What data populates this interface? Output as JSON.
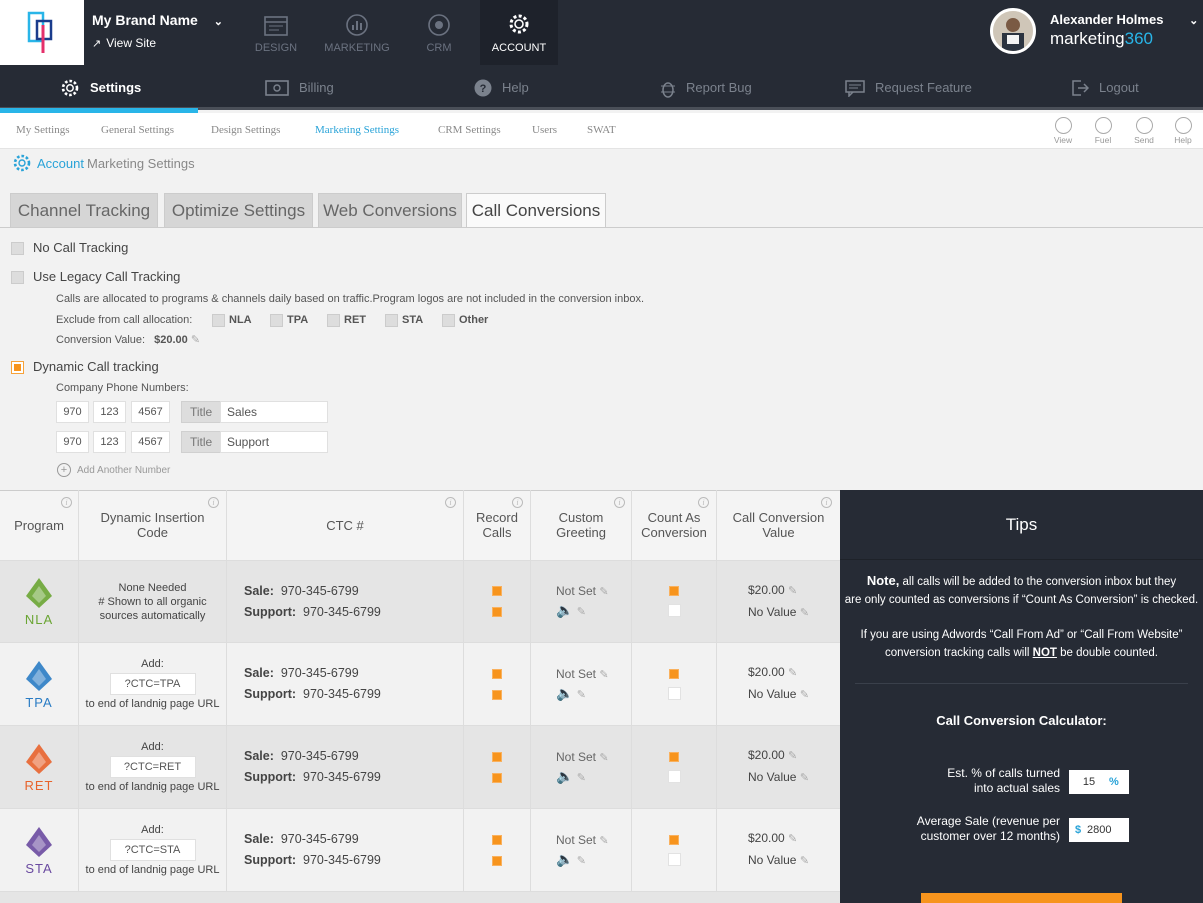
{
  "brand": {
    "name": "My Brand Name",
    "view_site": "View Site"
  },
  "topnav": [
    {
      "label": "DESIGN"
    },
    {
      "label": "MARKETING"
    },
    {
      "label": "CRM"
    },
    {
      "label": "ACCOUNT"
    }
  ],
  "user": {
    "name": "Alexander Holmes",
    "product_a": "marketing",
    "product_b": "360"
  },
  "subnav": [
    {
      "label": "Settings"
    },
    {
      "label": "Billing"
    },
    {
      "label": "Help"
    },
    {
      "label": "Report Bug"
    },
    {
      "label": "Request Feature"
    },
    {
      "label": "Logout"
    }
  ],
  "settingstabs": [
    {
      "label": "My Settings"
    },
    {
      "label": "General Settings"
    },
    {
      "label": "Design Settings"
    },
    {
      "label": "Marketing Settings"
    },
    {
      "label": "CRM Settings"
    },
    {
      "label": "Users"
    },
    {
      "label": "SWAT"
    }
  ],
  "righticons": [
    {
      "label": "View"
    },
    {
      "label": "Fuel"
    },
    {
      "label": "Send"
    },
    {
      "label": "Help"
    }
  ],
  "breadcrumb": {
    "account": "Account",
    "page": "Marketing Settings"
  },
  "maintabs": [
    {
      "label": "Channel Tracking"
    },
    {
      "label": "Optimize Settings"
    },
    {
      "label": "Web Conversions"
    },
    {
      "label": "Call Conversions"
    }
  ],
  "options": {
    "none": "No Call Tracking",
    "legacy": "Use Legacy Call Tracking",
    "legacy_desc": "Calls are allocated to programs & channels daily based on traffic.Program logos are not included in the conversion inbox.",
    "exclude_label": "Exclude from call allocation:",
    "exclude": [
      "NLA",
      "TPA",
      "RET",
      "STA",
      "Other"
    ],
    "conv_label": "Conversion Value:",
    "conv_value": "$20.00",
    "dynamic": "Dynamic Call tracking",
    "phones_label": "Company Phone Numbers:",
    "phones": [
      {
        "a": "970",
        "b": "123",
        "c": "4567",
        "title_label": "Title",
        "title": "Sales"
      },
      {
        "a": "970",
        "b": "123",
        "c": "4567",
        "title_label": "Title",
        "title": "Support"
      }
    ],
    "add_number": "Add Another Number"
  },
  "table": {
    "headers": {
      "program": "Program",
      "dic": "Dynamic Insertion Code",
      "ctc": "CTC #",
      "record": "Record Calls",
      "greeting": "Custom Greeting",
      "count": "Count As Conversion",
      "value": "Call Conversion Value"
    },
    "rows": [
      {
        "program": "NLA",
        "color": "#6aa533",
        "dic": "None Needed\n# Shown to all organic sources automatically",
        "sale_label": "Sale:",
        "sale": "970-345-6799",
        "support_label": "Support:",
        "support": "970-345-6799",
        "greeting": "Not Set",
        "value_a": "$20.00",
        "value_b": "No Value"
      },
      {
        "program": "TPA",
        "color": "#2a7cc4",
        "dic_add": "Add:",
        "dic_code": "?CTC=TPA",
        "dic_tail": "to end of landnig page URL",
        "sale_label": "Sale:",
        "sale": "970-345-6799",
        "support_label": "Support:",
        "support": "970-345-6799",
        "greeting": "Not Set",
        "value_a": "$20.00",
        "value_b": "No Value"
      },
      {
        "program": "RET",
        "color": "#e8632c",
        "dic_add": "Add:",
        "dic_code": "?CTC=RET",
        "dic_tail": "to end of landnig page URL",
        "sale_label": "Sale:",
        "sale": "970-345-6799",
        "support_label": "Support:",
        "support": "970-345-6799",
        "greeting": "Not Set",
        "value_a": "$20.00",
        "value_b": "No Value"
      },
      {
        "program": "STA",
        "color": "#6a4aa0",
        "dic_add": "Add:",
        "dic_code": "?CTC=STA",
        "dic_tail": "to end of landnig page URL",
        "sale_label": "Sale:",
        "sale": "970-345-6799",
        "support_label": "Support:",
        "support": "970-345-6799",
        "greeting": "Not Set",
        "value_a": "$20.00",
        "value_b": "No Value"
      }
    ]
  },
  "tips": {
    "title": "Tips",
    "note_bold": "Note,",
    "note_rest_1": " all calls will be added to the conversion inbox but they",
    "note_rest_2": "are only counted as conversions if “Count As Conversion” is checked.",
    "adwords_1": "If you are using Adwords “Call From Ad” or “Call From Website”",
    "adwords_2a": "conversion tracking calls will ",
    "adwords_not": "NOT",
    "adwords_2b": " be double counted.",
    "calc_title": "Call Conversion Calculator:",
    "est_label_1": "Est. % of calls turned",
    "est_label_2": "into actual sales",
    "est_value": "15",
    "est_unit": "%",
    "avg_label_1": "Average Sale (revenue per",
    "avg_label_2": "customer over 12 months)",
    "avg_unit": "$",
    "avg_value": "2800"
  }
}
